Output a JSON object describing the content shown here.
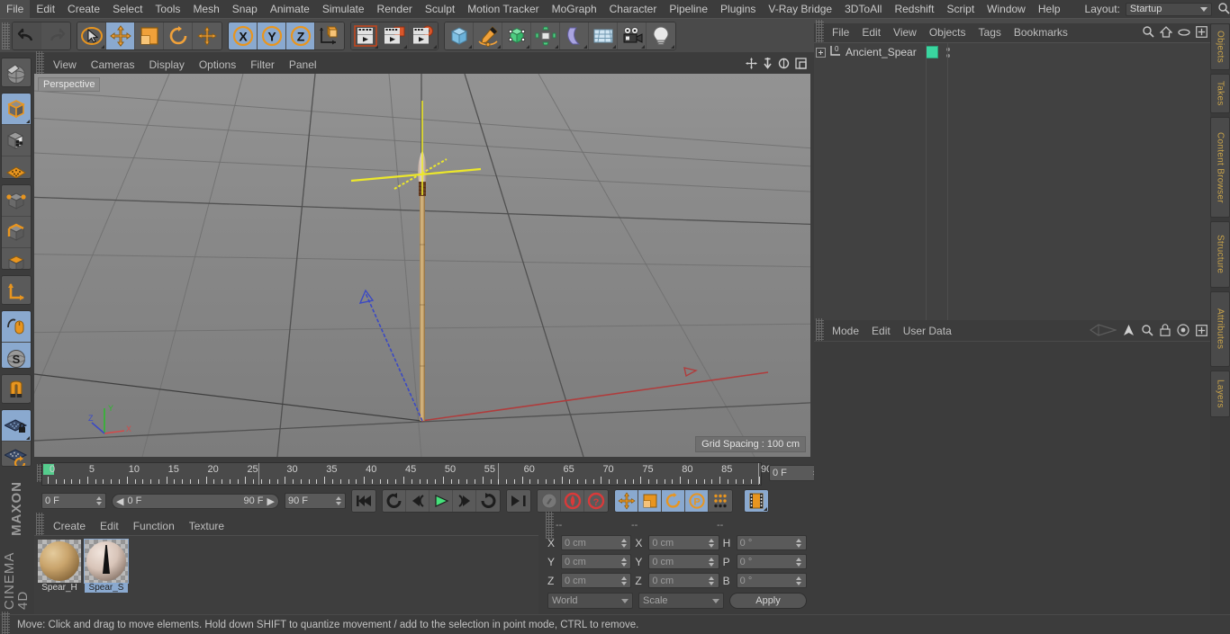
{
  "app": {
    "brand_line1": "MAXON",
    "brand_line2": "CINEMA 4D"
  },
  "menubar": {
    "items": [
      "File",
      "Edit",
      "Create",
      "Select",
      "Tools",
      "Mesh",
      "Snap",
      "Animate",
      "Simulate",
      "Render",
      "Sculpt",
      "Motion Tracker",
      "MoGraph",
      "Character",
      "Pipeline",
      "Plugins",
      "V-Ray Bridge",
      "3DToAll",
      "Redshift",
      "Script",
      "Window",
      "Help"
    ],
    "layout_label": "Layout:",
    "layout_value": "Startup",
    "search_icon": "magnifier-icon"
  },
  "toolbar": {
    "groups": [
      {
        "name": "undo-redo",
        "buttons": [
          {
            "icon": "undo-icon",
            "label": "Undo",
            "state": "normal"
          },
          {
            "icon": "redo-icon",
            "label": "Redo",
            "state": "disabled"
          }
        ]
      },
      {
        "name": "transform-tools",
        "buttons": [
          {
            "icon": "select-arrow-icon",
            "label": "Live Selection",
            "state": "normal"
          },
          {
            "icon": "move-icon",
            "label": "Move",
            "state": "active"
          },
          {
            "icon": "scale-icon",
            "label": "Scale",
            "state": "normal"
          },
          {
            "icon": "rotate-icon",
            "label": "Rotate",
            "state": "normal"
          },
          {
            "icon": "move-plus-icon",
            "label": "Move (alt)",
            "state": "normal"
          }
        ]
      },
      {
        "name": "axis-locks",
        "buttons": [
          {
            "icon": "axis-x-icon",
            "label": "X",
            "state": "active"
          },
          {
            "icon": "axis-y-icon",
            "label": "Y",
            "state": "active"
          },
          {
            "icon": "axis-z-icon",
            "label": "Z",
            "state": "active"
          },
          {
            "icon": "world-axis-icon",
            "label": "World / Object",
            "state": "normal"
          }
        ]
      },
      {
        "name": "render-tools",
        "buttons": [
          {
            "icon": "render-view-icon",
            "label": "Render View",
            "state": "normal"
          },
          {
            "icon": "render-picture-viewer-icon",
            "label": "Render to Picture Viewer",
            "state": "normal"
          },
          {
            "icon": "render-settings-icon",
            "label": "Edit Render Settings",
            "state": "normal"
          }
        ]
      },
      {
        "name": "create-objects",
        "buttons": [
          {
            "icon": "cube-primitive-icon",
            "label": "Add Cube Object",
            "state": "normal"
          },
          {
            "icon": "spline-pen-icon",
            "label": "Add Spline",
            "state": "normal"
          },
          {
            "icon": "generator-nurbs-icon",
            "label": "Add Generator",
            "state": "normal"
          },
          {
            "icon": "mograph-cloner-icon",
            "label": "Add MoGraph Object",
            "state": "normal"
          },
          {
            "icon": "deformer-bend-icon",
            "label": "Add Deformer",
            "state": "normal"
          },
          {
            "icon": "environment-floor-icon",
            "label": "Add Scene Object",
            "state": "normal"
          },
          {
            "icon": "camera-icon",
            "label": "Add Camera",
            "state": "normal"
          },
          {
            "icon": "light-bulb-icon",
            "label": "Add Light",
            "state": "normal"
          }
        ]
      }
    ]
  },
  "lefttools": {
    "buttons": [
      {
        "icon": "make-editable-icon",
        "label": "Make Editable",
        "state": "normal"
      },
      {
        "icon": "model-mode-cube-icon",
        "label": "Model Mode",
        "state": "active"
      },
      {
        "icon": "texture-mode-icon",
        "label": "Texture Mode",
        "state": "normal"
      },
      {
        "icon": "polygon-grid-icon",
        "label": "Enable Axis Modification",
        "state": "normal"
      },
      {
        "icon": "points-mode-icon",
        "label": "Points Mode",
        "state": "normal"
      },
      {
        "icon": "edges-mode-icon",
        "label": "Edges Mode",
        "state": "normal"
      },
      {
        "icon": "polygons-mode-icon",
        "label": "Polygons Mode",
        "state": "normal"
      },
      {
        "icon": "axis-l-icon",
        "label": "Enable Axis",
        "state": "normal"
      },
      {
        "icon": "mouse-viewport-icon",
        "label": "Viewport Solo Off",
        "state": "active"
      },
      {
        "icon": "soft-selection-s-icon",
        "label": "Soft Selection",
        "state": "active"
      },
      {
        "icon": "magnet-icon",
        "label": "Magnet",
        "state": "normal"
      },
      {
        "icon": "workplane-lock-icon",
        "label": "Lock Workplane",
        "state": "active"
      },
      {
        "icon": "workplane-rotate-icon",
        "label": "Planar Workplane Mode",
        "state": "normal"
      }
    ]
  },
  "viewport": {
    "menu": [
      "View",
      "Cameras",
      "Display",
      "Options",
      "Filter",
      "Panel"
    ],
    "corner_icons": [
      "pan-icon",
      "zoom-icon",
      "rotate-icon",
      "maximize-icon"
    ],
    "label": "Perspective",
    "grid_spacing": "Grid Spacing : 100 cm",
    "axis_gizmo": {
      "x": "X",
      "y": "Y",
      "z": "Z"
    },
    "scene_object": "Ancient_Spear"
  },
  "timeline": {
    "ruler_labels": [
      "0",
      "5",
      "10",
      "15",
      "20",
      "25",
      "30",
      "35",
      "40",
      "45",
      "50",
      "55",
      "60",
      "65",
      "70",
      "75",
      "80",
      "85",
      "90"
    ],
    "ruler_min": 0,
    "ruler_max": 90,
    "current_frame_field": "0 F",
    "start_frame": "0 F",
    "range_start": "0 F",
    "range_end": "90 F",
    "end_frame": "90 F",
    "transport": [
      {
        "icon": "go-to-start-icon",
        "label": "Go to Start"
      },
      {
        "icon": "loop-back-icon",
        "label": "Go to Previous Key"
      },
      {
        "icon": "step-back-icon",
        "label": "Go to Previous Frame"
      },
      {
        "icon": "play-icon",
        "label": "Play Forwards"
      },
      {
        "icon": "step-forward-icon",
        "label": "Go to Next Frame"
      },
      {
        "icon": "loop-forward-icon",
        "label": "Go to Next Key"
      },
      {
        "icon": "go-to-end-icon",
        "label": "Go to End"
      }
    ],
    "record_group": [
      {
        "icon": "autokey-wrench-icon",
        "label": "Record Active Objects",
        "state": "disabled"
      },
      {
        "icon": "autokeying-icon",
        "label": "Autokeying",
        "state": "normal"
      },
      {
        "icon": "keyframe-selection-icon",
        "label": "Keyframe Selection",
        "state": "normal"
      }
    ],
    "param_group": [
      {
        "icon": "key-position-icon",
        "label": "Position",
        "state": "active"
      },
      {
        "icon": "key-scale-icon",
        "label": "Scale",
        "state": "active"
      },
      {
        "icon": "key-rotation-icon",
        "label": "Rotation",
        "state": "active"
      },
      {
        "icon": "key-param-p-icon",
        "label": "Parameter",
        "state": "active"
      },
      {
        "icon": "key-pla-icon",
        "label": "Point Level Animation",
        "state": "normal"
      }
    ],
    "timeline_toggle": {
      "icon": "film-strip-icon",
      "label": "Animation Mode",
      "state": "active"
    }
  },
  "material_manager": {
    "menu": [
      "Create",
      "Edit",
      "Function",
      "Texture"
    ],
    "materials": [
      {
        "name": "Spear_H",
        "selected": false,
        "swatch": "wood"
      },
      {
        "name": "Spear_S",
        "selected": true,
        "swatch": "stone"
      }
    ]
  },
  "coordinates": {
    "headers": [
      "--",
      "--",
      "--"
    ],
    "rows": [
      {
        "pos_label": "X",
        "pos_value": "0 cm",
        "size_label": "X",
        "size_value": "0 cm",
        "rot_label": "H",
        "rot_value": "0 °"
      },
      {
        "pos_label": "Y",
        "pos_value": "0 cm",
        "size_label": "Y",
        "size_value": "0 cm",
        "rot_label": "P",
        "rot_value": "0 °"
      },
      {
        "pos_label": "Z",
        "pos_value": "0 cm",
        "size_label": "Z",
        "size_value": "0 cm",
        "rot_label": "B",
        "rot_value": "0 °"
      }
    ],
    "coord_system": "World",
    "mode": "Scale",
    "apply_label": "Apply"
  },
  "object_manager": {
    "menu": [
      "File",
      "Edit",
      "View",
      "Objects",
      "Tags",
      "Bookmarks"
    ],
    "icons": [
      "search-icon",
      "home-icon",
      "ellipse-icon",
      "plus-box-icon"
    ],
    "objects": [
      {
        "name": "Ancient_Spear",
        "icon": "null-object-icon",
        "tag_color": "#3ad6a0",
        "expandable": true
      }
    ]
  },
  "attribute_manager": {
    "menu": [
      "Mode",
      "Edit",
      "User Data"
    ],
    "icons": [
      "history-icon",
      "pin-arrow-icon",
      "search-icon",
      "lock-icon",
      "target-icon",
      "plus-box-icon"
    ]
  },
  "vertical_tabs": [
    {
      "label": "Objects",
      "accent": "#c8a34a"
    },
    {
      "label": "Takes",
      "accent": "#c8a34a"
    },
    {
      "label": "Content Browser",
      "accent": "#c8a34a"
    },
    {
      "label": "Structure",
      "accent": "#c8a34a"
    },
    {
      "label": "Attributes",
      "accent": "#c8a34a"
    },
    {
      "label": "Layers",
      "accent": "#c8a34a"
    }
  ],
  "statusbar": {
    "message": "Move: Click and drag to move elements. Hold down SHIFT to quantize movement / add to the selection in point mode, CTRL to remove."
  },
  "colors": {
    "window_bg": "#3c3c3c",
    "toolbar_bg": "#4a4a4a",
    "accent_blue": "#8aa9cf",
    "accent_orange": "#e8951f",
    "tag_green": "#3ad6a0",
    "axis_x": "#cc3333",
    "axis_y": "#33cc33",
    "axis_z": "#3355cc",
    "selection_yellow": "#e8e82a"
  }
}
